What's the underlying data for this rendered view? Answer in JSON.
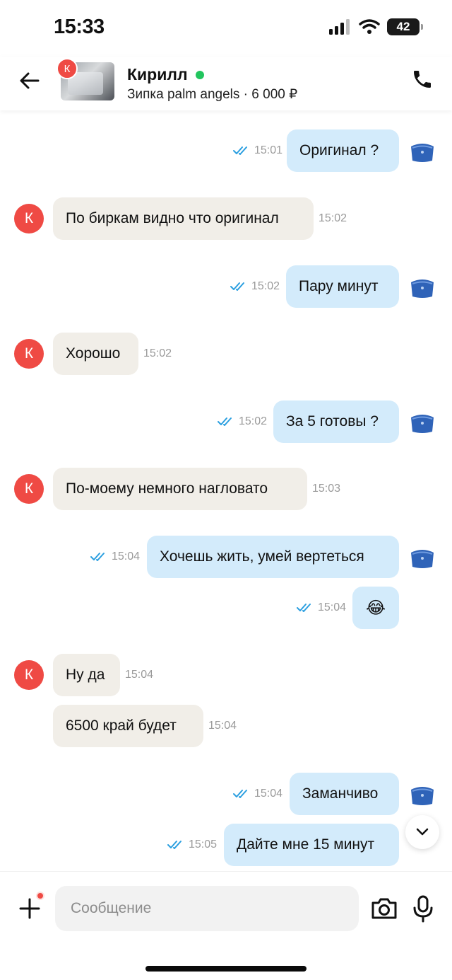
{
  "status_bar": {
    "time": "15:33",
    "battery": "42"
  },
  "header": {
    "contact_name": "Кирилл",
    "avatar_letter": "К",
    "listing": "Зипка palm angels · 6 000 ₽",
    "online": true
  },
  "messages": [
    {
      "dir": "out",
      "text": "Оригинал ?",
      "time": "15:01",
      "read": true
    },
    {
      "dir": "in",
      "text": "По биркам видно что оригинал",
      "time": "15:02",
      "avatar": "К"
    },
    {
      "dir": "out",
      "text": "Пару минут",
      "time": "15:02",
      "read": true
    },
    {
      "dir": "in",
      "text": "Хорошо",
      "time": "15:02",
      "avatar": "К"
    },
    {
      "dir": "out",
      "text": "За 5 готовы ?",
      "time": "15:02",
      "read": true
    },
    {
      "dir": "in",
      "text": "По-моему немного нагловато",
      "time": "15:03",
      "avatar": "К"
    },
    {
      "dir": "out",
      "text": "Хочешь жить, умей вертеться",
      "time": "15:04",
      "read": true
    },
    {
      "dir": "out",
      "text": "😂",
      "time": "15:04",
      "read": true
    },
    {
      "dir": "in",
      "text": "Ну да",
      "time": "15:04",
      "avatar": "К"
    },
    {
      "dir": "in",
      "text": "6500 край будет",
      "time": "15:04"
    },
    {
      "dir": "out",
      "text": "Заманчиво",
      "time": "15:04",
      "read": true
    },
    {
      "dir": "out",
      "text": "Дайте мне 15 минут",
      "time": "15:05",
      "read": true
    }
  ],
  "composer": {
    "placeholder": "Сообщение"
  },
  "colors": {
    "outgoing_bubble": "#d3ebfb",
    "incoming_bubble": "#f1eee8",
    "accent_red": "#ef4a44",
    "online_green": "#22c55e",
    "read_check": "#2b9fe0"
  },
  "icons": [
    "back-arrow-icon",
    "phone-icon",
    "double-check-icon",
    "bag-icon",
    "chevron-down-icon",
    "plus-icon",
    "camera-icon",
    "microphone-icon"
  ]
}
